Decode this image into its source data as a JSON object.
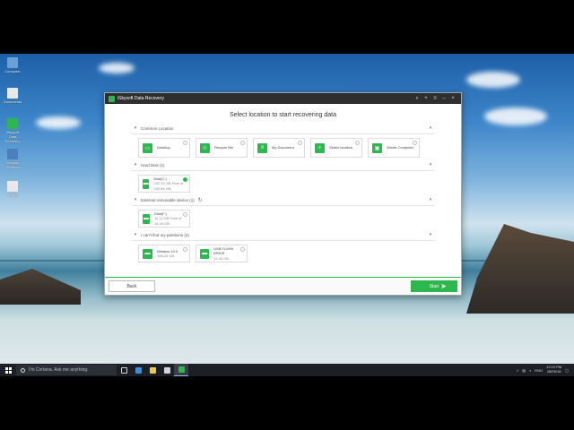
{
  "desktop": {
    "icons": [
      {
        "label": "Computer",
        "color": "#6aa0d8"
      },
      {
        "label": "Documents",
        "color": "#e8e8e8"
      },
      {
        "label": "iSkysoft Data Recovery",
        "color": "#2db84d"
      },
      {
        "label": "Desktop Shortcut",
        "color": "#4a7fc0"
      },
      {
        "label": "Notes",
        "color": "#e8e8e8"
      }
    ]
  },
  "window": {
    "title": "iSkysoft Data Recovery",
    "heading": "Select location to start recovering data",
    "sections": {
      "common": {
        "label": "Common Location",
        "tiles": [
          {
            "label": "Desktop",
            "icon": "desktop-icon",
            "glyph": "▭"
          },
          {
            "label": "Recycle Bin",
            "icon": "recycle-bin-icon",
            "glyph": "♲"
          },
          {
            "label": "My Document",
            "icon": "document-icon",
            "glyph": "≡"
          },
          {
            "label": "Select location",
            "icon": "search-icon",
            "glyph": "⌕"
          },
          {
            "label": "Whole Computer",
            "icon": "computer-icon",
            "glyph": "▣"
          }
        ]
      },
      "hard_disk": {
        "label": "Hard Disk (1)",
        "drives": [
          {
            "name": "Disk(C:)",
            "detail": "232.19 GB Free of 232.88 GB",
            "selected": true
          }
        ]
      },
      "removable": {
        "label": "External removable device (1)",
        "drives": [
          {
            "name": "Disk(F:)",
            "detail": "11.14 GB Free of 14.44 GB",
            "selected": false
          }
        ]
      },
      "lost": {
        "label": "I can't find my partitions (2)",
        "drives": [
          {
            "name": "Window 10 9",
            "detail": "195.20 GB",
            "selected": false
          },
          {
            "name": "USB FLASH DRIVE",
            "detail": "14.44 GB",
            "selected": false
          }
        ]
      }
    },
    "back_label": "Back",
    "start_label": "Start"
  },
  "taskbar": {
    "search_placeholder": "I'm Cortana. Ask me anything.",
    "apps": [
      {
        "name": "task-view",
        "color": "#cfd3da"
      },
      {
        "name": "edge",
        "color": "#3b8ee6"
      },
      {
        "name": "file-explorer",
        "color": "#f2c94c"
      },
      {
        "name": "store",
        "color": "#cfd3da"
      },
      {
        "name": "data-recovery",
        "color": "#2db84d",
        "active": true
      }
    ],
    "language": "ENG",
    "time": "12:10 PM",
    "date": "28/09/18"
  },
  "colors": {
    "accent": "#2db84d",
    "titlebar": "#2e2e2e",
    "taskbar": "#1c1f26"
  }
}
